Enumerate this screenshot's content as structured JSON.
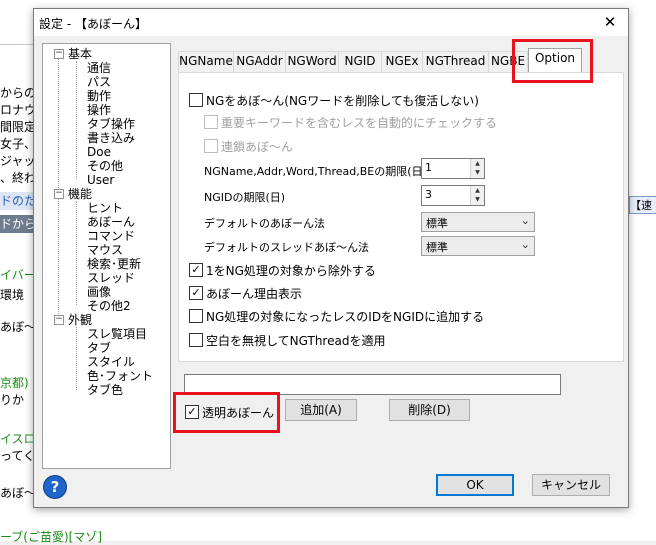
{
  "background": {
    "lines": [
      "からの",
      "ロナウ",
      "間限定",
      "女子、",
      "ジャッ",
      "、終わ",
      "ドのた",
      "ドから",
      "イバー",
      "環境",
      "あぼ〜",
      "京都)",
      "りか",
      "イスロ",
      "ってく",
      "あぼ〜"
    ],
    "right_fragment": "【速",
    "bottom_text": "ーブ(ご苗愛)[マゾ]"
  },
  "dialog": {
    "title": "設定 - 【あぼーん】",
    "close_glyph": "✕"
  },
  "tree": {
    "groups": [
      {
        "label": "基本",
        "toggle": "−",
        "items": [
          "通信",
          "パス",
          "動作",
          "操作",
          "タブ操作",
          "書き込み",
          "Doe",
          "その他",
          "User"
        ]
      },
      {
        "label": "機能",
        "toggle": "−",
        "items": [
          "ヒント",
          "あぼーん",
          "コマンド",
          "マウス",
          "検索･更新",
          "スレッド",
          "画像",
          "その他2"
        ]
      },
      {
        "label": "外観",
        "toggle": "−",
        "items": [
          "スレ覧項目",
          "タブ",
          "スタイル",
          "色･フォント",
          "タブ色"
        ]
      }
    ]
  },
  "tabs": [
    "NGName",
    "NGAddr",
    "NGWord",
    "NGID",
    "NGEx",
    "NGThread",
    "NGBE",
    "Option"
  ],
  "active_tab": "Option",
  "options": {
    "ng_abon_label": "NGをあぼ〜ん(NGワードを削除しても復活しない)",
    "ng_abon_checked": false,
    "keyword_check_label": "重要キーワードを含むレスを自動的にチェックする",
    "keyword_check_checked": false,
    "chain_abon_label": "連鎖あぼ〜ん",
    "chain_abon_checked": false,
    "ng_period_label": "NGName,Addr,Word,Thread,BEの期限(日)",
    "ng_period_value": "1",
    "ngid_period_label": "NGIDの期限(日)",
    "ngid_period_value": "3",
    "default_abon_label": "デフォルトのあぼーん法",
    "default_abon_value": "標準",
    "default_thread_abon_label": "デフォルトのスレッドあぼ〜ん法",
    "default_thread_abon_value": "標準",
    "exclude_first_label": "1をNG処理の対象から除外する",
    "exclude_first_checked": true,
    "show_reason_label": "あぼーん理由表示",
    "show_reason_checked": true,
    "add_id_label": "NG処理の対象になったレスのIDをNGIDに追加する",
    "add_id_checked": false,
    "ignore_space_label": "空白を無視してNGThreadを適用",
    "ignore_space_checked": false
  },
  "bottom": {
    "textbox_value": "",
    "transparent_label": "透明あぼーん",
    "transparent_checked": true,
    "add_label": "追加(A)",
    "delete_label": "削除(D)",
    "ok_label": "OK",
    "cancel_label": "キャンセル",
    "help_glyph": "?"
  },
  "check_glyph": "✓",
  "colors": {
    "highlight": "#e8131f",
    "accent": "#0078d7"
  }
}
